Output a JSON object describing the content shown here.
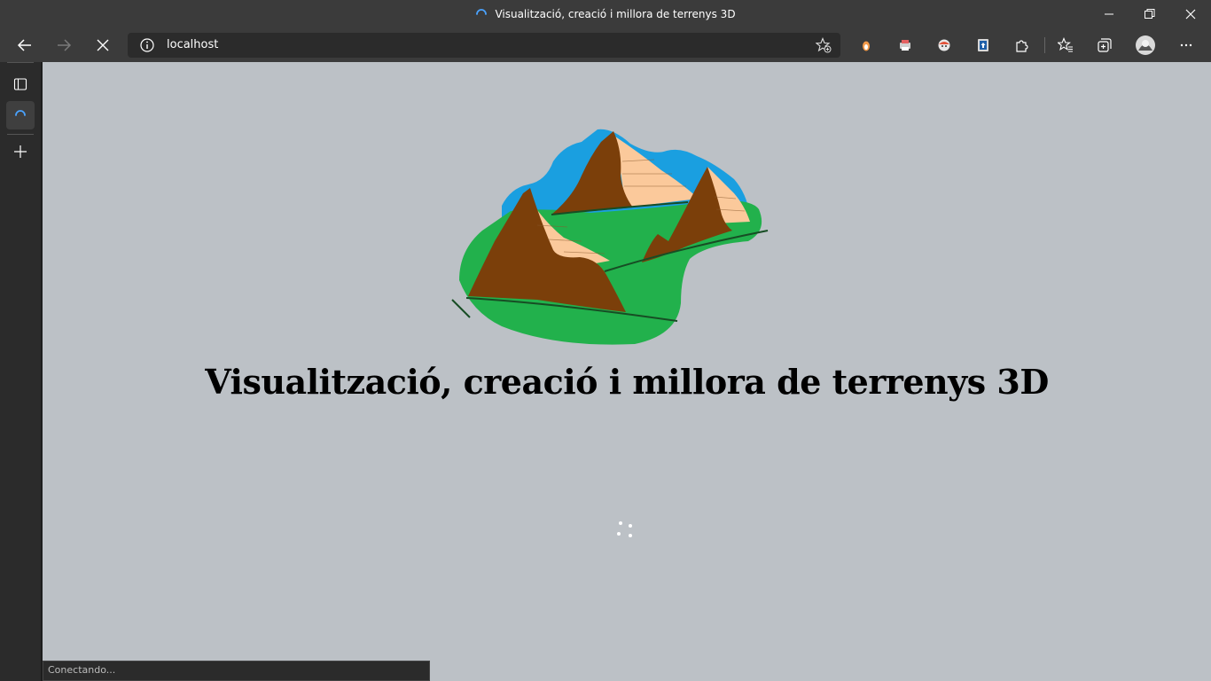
{
  "window": {
    "title": "Visualització, creació i millora de terrenys 3D"
  },
  "toolbar": {
    "address": "localhost"
  },
  "page": {
    "heading": "Visualització, creació i millora de terrenys 3D"
  },
  "statusbar": {
    "text": "Conectando..."
  },
  "colors": {
    "page_background": "#bcc1c6",
    "chrome": "#3b3b3b",
    "logo_water": "#1a9fe0",
    "logo_grass": "#22b14c",
    "logo_mountain": "#7b3f0a",
    "logo_snow": "#fbc99b",
    "spinner_accent": "#4aa3ff"
  },
  "icons": {
    "back": "arrow-left-icon",
    "forward": "arrow-right-icon",
    "stop": "close-icon",
    "site_info": "info-icon",
    "favorite_add": "star-add-icon",
    "extensions": "puzzle-icon",
    "favorites": "star-list-icon",
    "collections": "collections-icon",
    "more": "ellipsis-icon"
  }
}
